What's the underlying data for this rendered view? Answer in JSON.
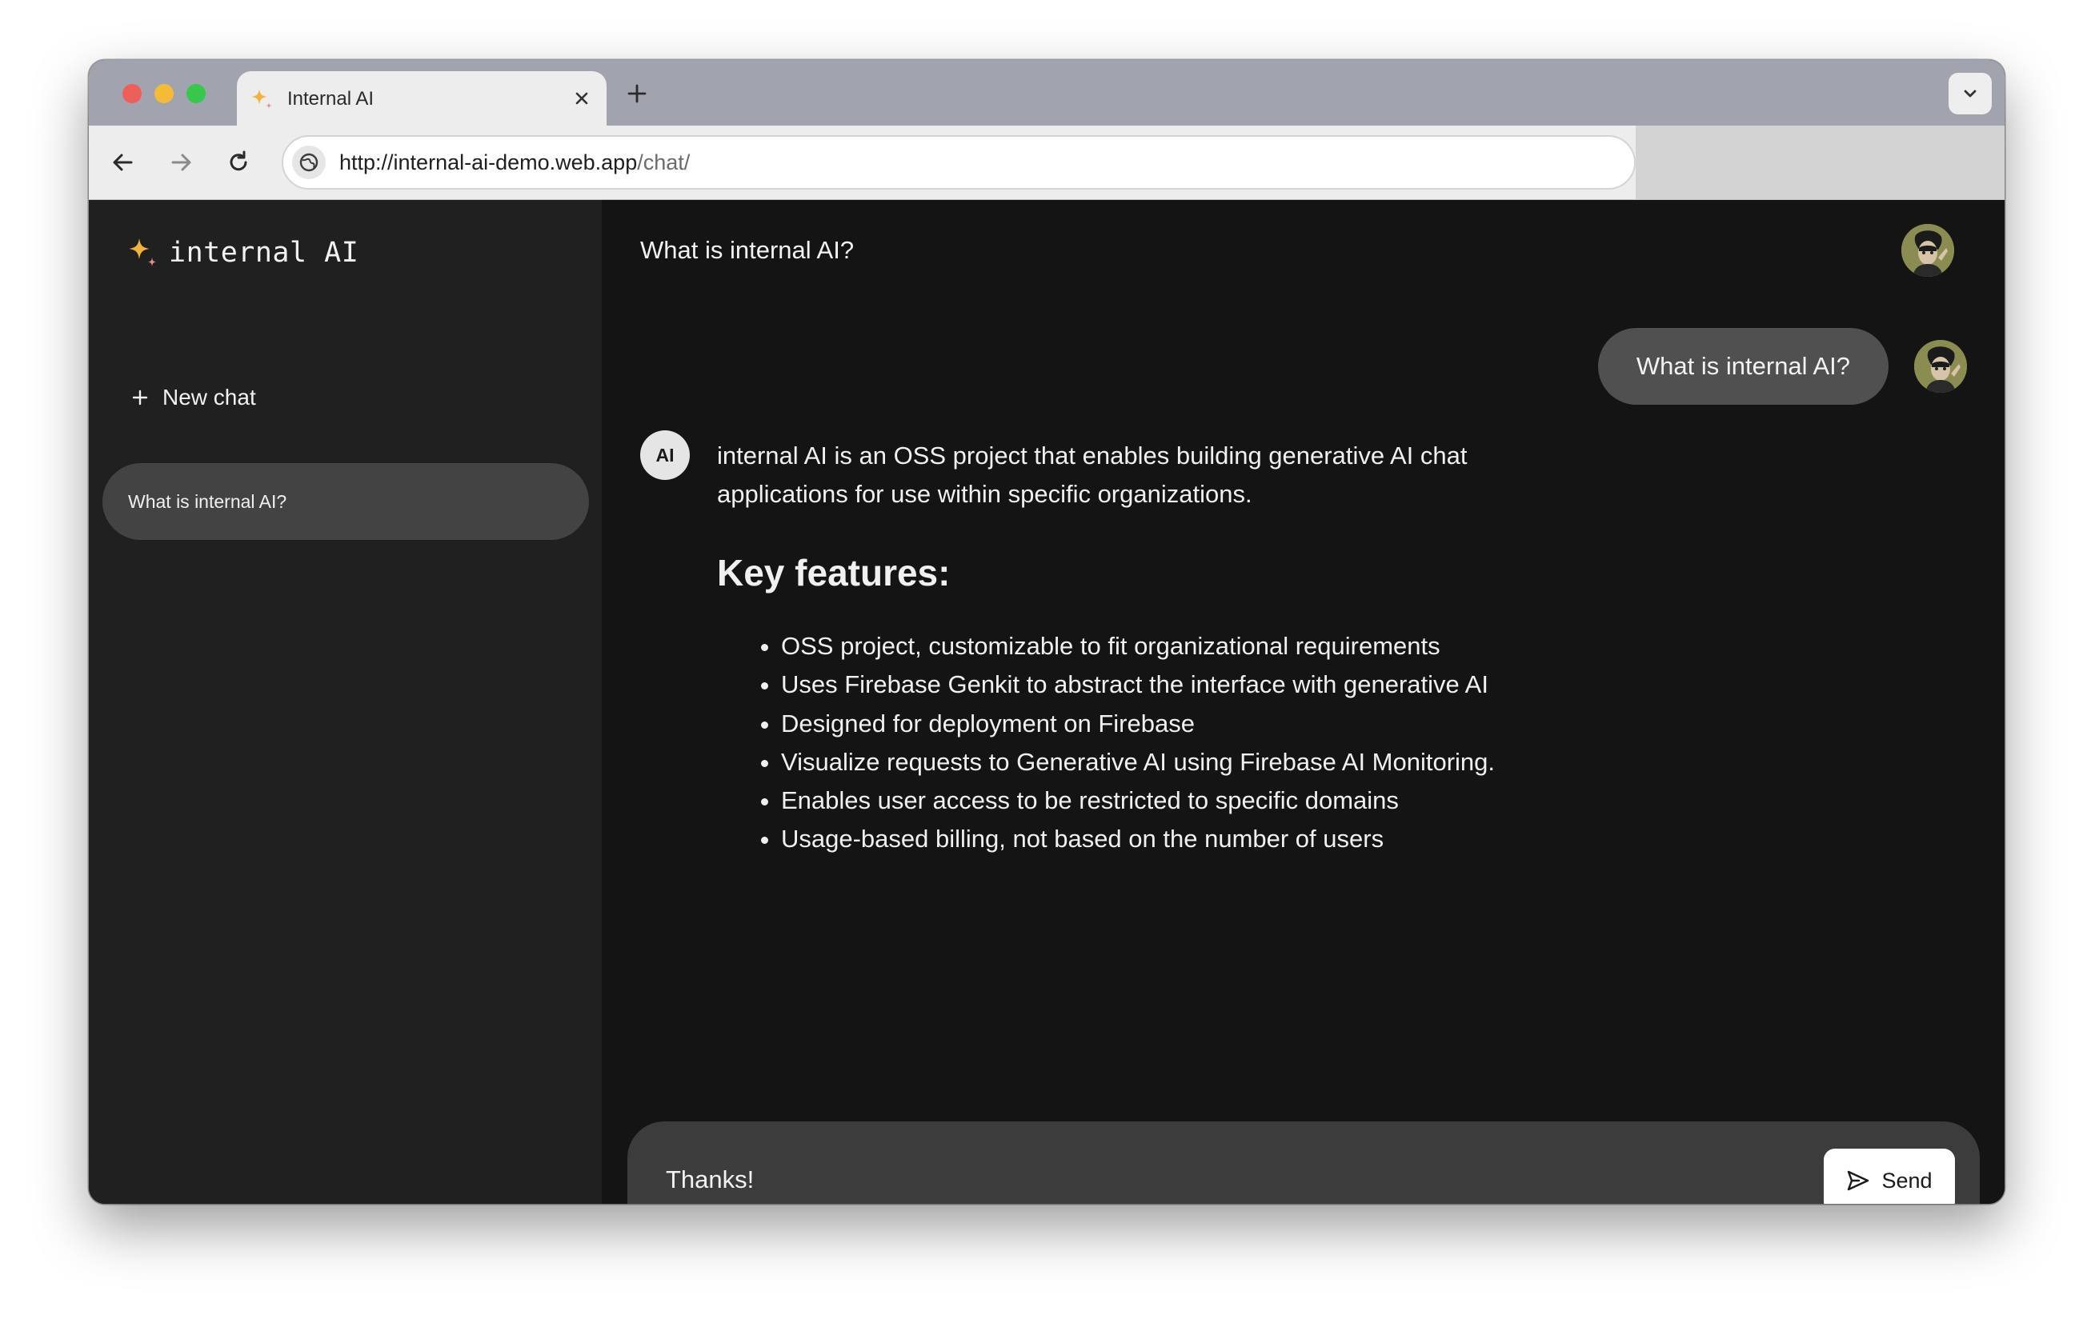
{
  "browser": {
    "tab": {
      "title": "Internal AI",
      "favicon": "sparkle-icon"
    },
    "url": {
      "host": "http://internal-ai-demo.web.app",
      "path": "/chat/"
    }
  },
  "app": {
    "logo_text": "internal AI",
    "new_chat_label": "New chat",
    "history": [
      {
        "title": "What is internal AI?",
        "selected": true
      }
    ]
  },
  "chat": {
    "title": "What is internal AI?",
    "user_message": "What is internal AI?",
    "ai_badge": "AI",
    "ai_response": {
      "intro": "internal AI is an OSS project that enables building generative AI chat applications for use within specific organizations.",
      "heading": "Key features:",
      "bullets": [
        "OSS project, customizable to fit organizational requirements",
        "Uses Firebase Genkit to abstract the interface with generative AI",
        "Designed for deployment on Firebase",
        "Visualize requests to Generative AI using Firebase AI Monitoring.",
        "Enables user access to be restricted to specific domains",
        "Usage-based billing, not based on the number of users"
      ]
    }
  },
  "composer": {
    "value": "Thanks!",
    "send_label": "Send"
  },
  "colors": {
    "sidebar_bg": "#202020",
    "main_bg": "#141414",
    "user_bubble": "#505050",
    "composer_bg": "#3c3c3c",
    "sparkle_gold": "#f2b33d",
    "sparkle_pink": "#f08a8a"
  }
}
